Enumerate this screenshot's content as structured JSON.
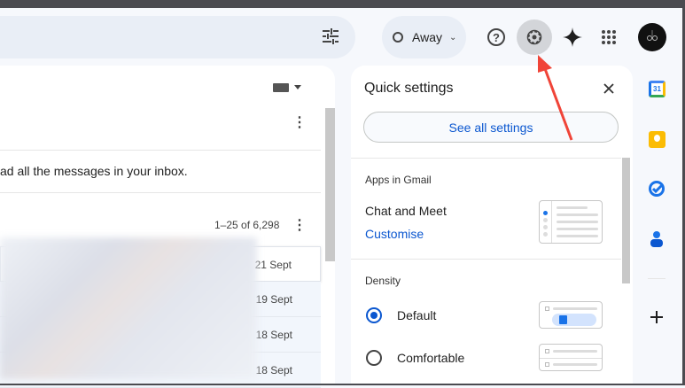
{
  "header": {
    "status": "Away",
    "icons": [
      "tune-icon",
      "help-icon",
      "settings-icon",
      "gemini-icon",
      "apps-icon",
      "avatar"
    ]
  },
  "mail": {
    "notice": "ad all the messages in your inbox.",
    "pagination": "1–25 of 6,298",
    "dates": [
      "21 Sept",
      "19 Sept",
      "18 Sept",
      "18 Sept"
    ]
  },
  "quick_settings": {
    "title": "Quick settings",
    "see_all": "See all settings",
    "apps_heading": "Apps in Gmail",
    "chat_meet": "Chat and Meet",
    "customise": "Customise",
    "density_heading": "Density",
    "density_options": [
      {
        "label": "Default",
        "selected": true
      },
      {
        "label": "Comfortable",
        "selected": false
      }
    ]
  },
  "colors": {
    "accent": "#0b57d0",
    "arrow": "#f04438"
  }
}
